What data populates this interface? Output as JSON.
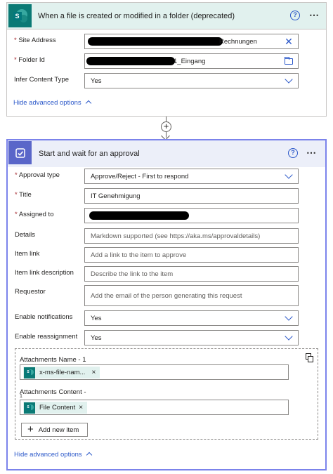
{
  "trigger": {
    "title": "When a file is created or modified in a folder (deprecated)",
    "help_glyph": "?",
    "more_glyph": "⋯",
    "fields": {
      "site_address": {
        "label": "Site Address",
        "required": "*",
        "value": "Rechnungen",
        "icon": "clear-x-icon"
      },
      "folder_id": {
        "label": "Folder Id",
        "required": "*",
        "value": "1_Eingang",
        "icon": "folder-icon"
      },
      "infer_content_type": {
        "label": "Infer Content Type",
        "value": "Yes",
        "icon": "chevron-down-icon"
      }
    },
    "advanced_toggle": "Hide advanced options"
  },
  "connector": {
    "plus_glyph": "+"
  },
  "approval": {
    "title": "Start and wait for an approval",
    "help_glyph": "?",
    "more_glyph": "⋯",
    "required_mark": "*",
    "approval_type": {
      "label": "Approval type",
      "value": "Approve/Reject - First to respond"
    },
    "title_field": {
      "label": "Title",
      "value": "IT Genehmigung"
    },
    "assigned_to": {
      "label": "Assigned to"
    },
    "details": {
      "label": "Details",
      "placeholder": "Markdown supported (see https://aka.ms/approvaldetails)"
    },
    "item_link": {
      "label": "Item link",
      "placeholder": "Add a link to the item to approve"
    },
    "item_link_description": {
      "label": "Item link description",
      "placeholder": "Describe the link to the item"
    },
    "requestor": {
      "label": "Requestor",
      "placeholder": "Add the email of the person generating this request"
    },
    "enable_notifications": {
      "label": "Enable notifications",
      "value": "Yes"
    },
    "enable_reassignment": {
      "label": "Enable reassignment",
      "value": "Yes"
    },
    "attachments": {
      "name_label": "Attachments Name - 1",
      "name_token": "x-ms-file-nam...",
      "content_label": "Attachments Content -",
      "content_label_wrap": "1",
      "content_token": "File Content",
      "token_remove": "×",
      "add_new_item": "Add new item",
      "add_glyph": "+"
    },
    "advanced_toggle": "Hide advanced options"
  },
  "colors": {
    "sharepoint_teal": "#0b7a75",
    "approval_purple": "#5a66c9",
    "link_blue": "#2b58c9",
    "required_red": "#a4262c"
  }
}
